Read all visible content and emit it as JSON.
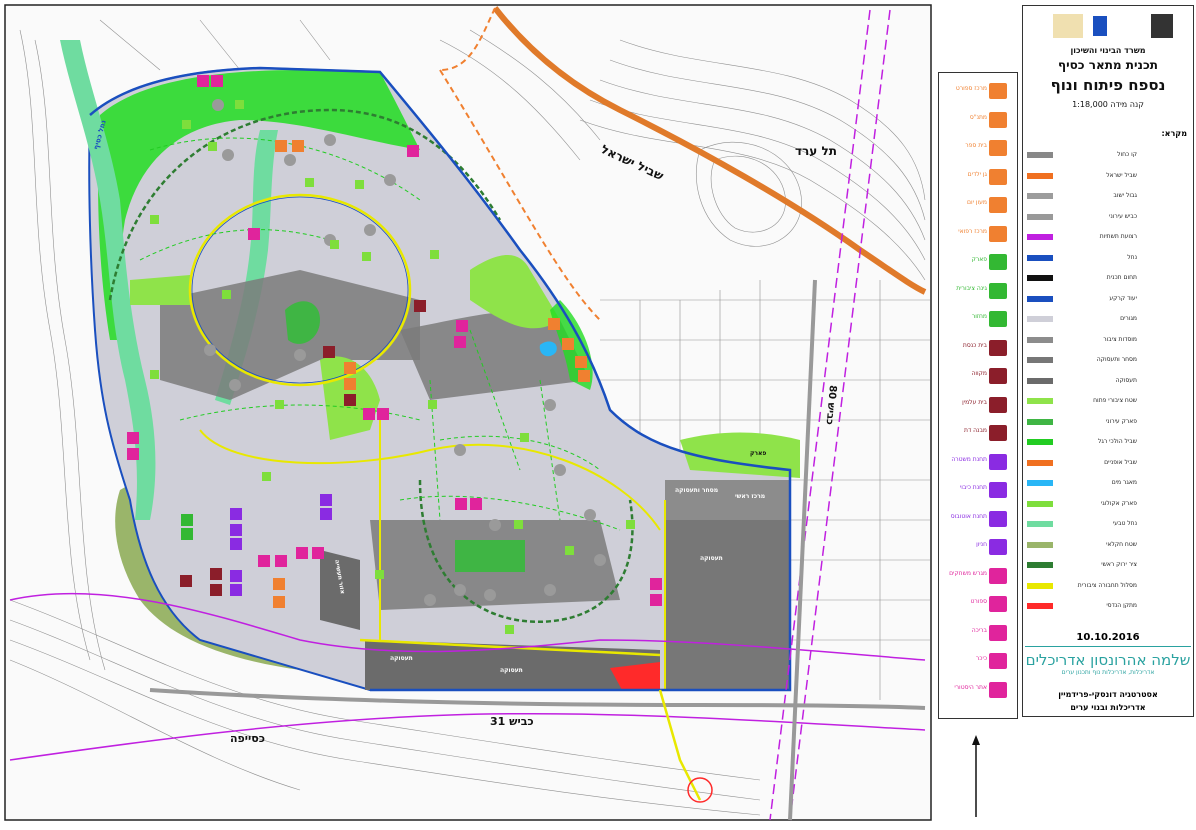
{
  "title_block": {
    "ministry": "משרד הבינוי והשיכון",
    "plan_title": "תכנית מתאר כסיף",
    "sheet_title": "נספח פיתוח ונוף",
    "scale": "קנה מידה 1:18,000",
    "date": "10.10.2016",
    "architect_name": "שלמה אהרונסון אדריכלים",
    "architect_sub": "אדריכלות, אדריכלות נוף ותכנון ערים",
    "footer_line1": "אסטרטגיה דונסקי-פרידמיין",
    "footer_line2": "אדריכלות ובנוי ערים"
  },
  "legend_panel": {
    "key_heading": "מקרא:",
    "rows": [
      {
        "label": "קו כחול",
        "color": "#888888"
      },
      {
        "label": "שביל ישראל",
        "color": "#f07020"
      },
      {
        "label": "גבול ישוב",
        "color": "#9c9c9c"
      },
      {
        "label": "כביש עירוני",
        "color": "#999999"
      },
      {
        "label": "רצועת תשתיות",
        "color": "#c020e0"
      },
      {
        "label": "נחל",
        "color": "#1a4fbf"
      },
      {
        "label": "תחום תכנית",
        "color": "#111111"
      },
      {
        "label": "יעוד קרקע",
        "color": "#1a4fbf"
      },
      {
        "label": "מגורים",
        "color": "#cfcfd8"
      },
      {
        "label": "מוסדות ציבור",
        "color": "#8c8c8c"
      },
      {
        "label": "מסחר ותעסוקה",
        "color": "#777777"
      },
      {
        "label": "תעסוקה",
        "color": "#6b6b6b"
      },
      {
        "label": "שטח ציבורי פתוח",
        "color": "#8fe34a"
      },
      {
        "label": "פארק עירוני",
        "color": "#3fb544"
      },
      {
        "label": "שביל הולכי רגל",
        "color": "#22cc22"
      },
      {
        "label": "שביל אופניים",
        "color": "#f07020"
      },
      {
        "label": "מאגר מים",
        "color": "#29b6f6"
      },
      {
        "label": "פארק אקולוגי",
        "color": "#7ede3c"
      },
      {
        "label": "נחל טבעי",
        "color": "#6fdca0"
      },
      {
        "label": "שטח חקלאי",
        "color": "#9ab56a"
      },
      {
        "label": "ציר ירוק ראשי",
        "color": "#2e7d32"
      },
      {
        "label": "מסלול תחבורה ציבורית",
        "color": "#e8e800"
      },
      {
        "label": "מתקן הנדסי",
        "color": "#ff2a2a"
      }
    ]
  },
  "legend_column": {
    "items": [
      {
        "label": "מרכז ספורט",
        "color": "#f08030",
        "icon": "sports-icon"
      },
      {
        "label": "מתנ\"ס",
        "color": "#f08030",
        "icon": "community-icon"
      },
      {
        "label": "בית ספר",
        "color": "#f08030",
        "icon": "school-icon"
      },
      {
        "label": "גן ילדים",
        "color": "#f08030",
        "icon": "kindergarten-icon"
      },
      {
        "label": "מעון יום",
        "color": "#f08030",
        "icon": "daycare-icon"
      },
      {
        "label": "מרכז רפואי",
        "color": "#f08030",
        "icon": "medical-icon"
      },
      {
        "label": "פארק",
        "color": "#33b833",
        "icon": "park-icon"
      },
      {
        "label": "גינה ציבורית",
        "color": "#33b833",
        "icon": "garden-icon"
      },
      {
        "label": "מחזור",
        "color": "#33b833",
        "icon": "recycle-icon"
      },
      {
        "label": "בית כנסת",
        "color": "#8b1e2a",
        "icon": "synagogue-icon"
      },
      {
        "label": "מקווה",
        "color": "#8b1e2a",
        "icon": "mikveh-icon"
      },
      {
        "label": "בית עלמין",
        "color": "#8b1e2a",
        "icon": "cemetery-icon"
      },
      {
        "label": "מבנה דת",
        "color": "#8b1e2a",
        "icon": "religious-icon"
      },
      {
        "label": "תחנת משטרה",
        "color": "#8a2be2",
        "icon": "police-icon"
      },
      {
        "label": "תחנת כיבוי",
        "color": "#8a2be2",
        "icon": "fire-icon"
      },
      {
        "label": "תחנת אוטובוס",
        "color": "#8a2be2",
        "icon": "bus-icon"
      },
      {
        "label": "חניון",
        "color": "#8a2be2",
        "icon": "parking-icon"
      },
      {
        "label": "מגרש משחקים",
        "color": "#e0249c",
        "icon": "playground-icon"
      },
      {
        "label": "ספורט",
        "color": "#e0249c",
        "icon": "ball-icon"
      },
      {
        "label": "בריכה",
        "color": "#e0249c",
        "icon": "pool-icon"
      },
      {
        "label": "כיכר",
        "color": "#e0249c",
        "icon": "square-icon"
      },
      {
        "label": "אתר היסטורי",
        "color": "#e0249c",
        "icon": "historic-icon"
      }
    ]
  },
  "map_labels": {
    "tel_arad": "תל ערד",
    "israel_trail": "שביל ישראל",
    "road_80": "כביש 80",
    "road_31": "כביש 31",
    "kseifa": "כסייפה",
    "wadi": "נחל כסיף",
    "zone_employment_1": "תעסוקה",
    "zone_employment_2": "תעסוקה",
    "zone_employment_3": "תעסוקה",
    "zone_commerce_1": "מסחר ותעסוקה",
    "zone_commerce_2": "מרכז ראשי",
    "zone_industry": "אזור תעשייה",
    "zone_east_park": "פארק"
  },
  "colors": {
    "residential": "#cfcfd8",
    "dark_gray": "#7b7b7b",
    "park_green": "#8fe34a",
    "bright_green": "#22dd22",
    "river": "#6fdca0",
    "agricultural": "#9ab56a",
    "plan_boundary": "#1a4fbf",
    "israel_trail": "#e07a2a",
    "infrastructure": "#c020e0",
    "engineering": "#ff2a2a",
    "transit": "#e8e800",
    "green_axis": "#2e7d32",
    "contour": "#8a8a8a"
  }
}
